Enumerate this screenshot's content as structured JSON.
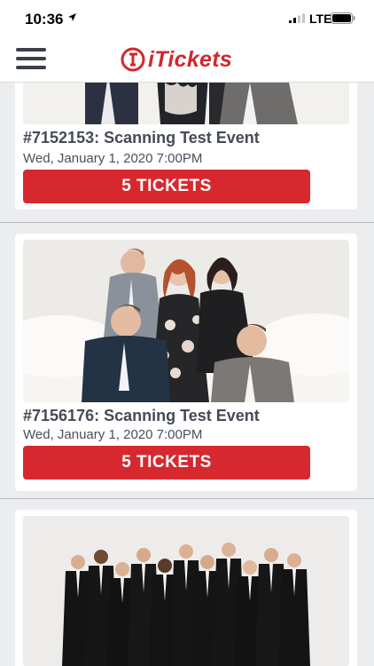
{
  "status_bar": {
    "time": "10:36",
    "network": "LTE",
    "icons": [
      "location-arrow-icon",
      "signal-bars-icon",
      "battery-icon"
    ]
  },
  "header": {
    "logo_text": "iTickets",
    "logo_icon": "itickets-logo-icon",
    "menu_icon": "hamburger-menu-icon",
    "brand_color": "#d0282e"
  },
  "events": [
    {
      "title": "#7152153: Scanning Test Event",
      "date": "Wed, January 1, 2020 7:00PM",
      "button_label": "5 TICKETS",
      "image": "group photo of four people on white sofa"
    },
    {
      "title": "#7156176: Scanning Test Event",
      "date": "Wed, January 1, 2020 7:00PM",
      "button_label": "5 TICKETS",
      "image": "group photo of four people on white sofa"
    },
    {
      "title": "",
      "date": "",
      "button_label": "",
      "image": "choir group in tuxedos"
    }
  ],
  "colors": {
    "button": "#d7282f",
    "title_text": "#454a55",
    "background": "#ecedef"
  }
}
